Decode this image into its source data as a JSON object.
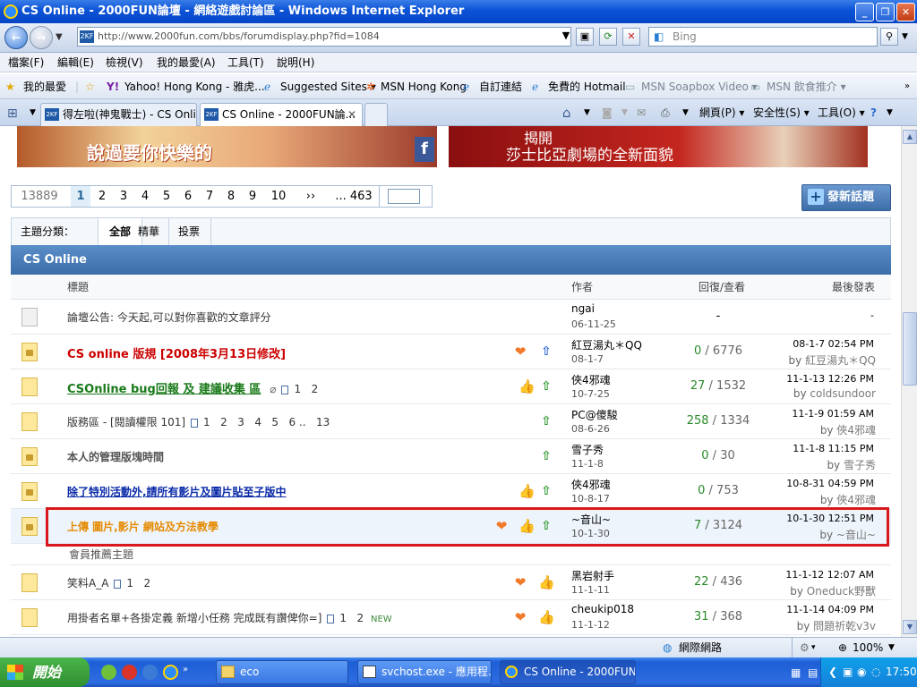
{
  "window": {
    "title": "CS Online - 2000FUN論壇 - 網絡遊戲討論區 - Windows Internet Explorer"
  },
  "address": {
    "url": "http://www.2000fun.com/bbs/forumdisplay.php?fid=1084",
    "favicon": "2KF"
  },
  "search": {
    "placeholder": "Bing"
  },
  "menu": [
    "檔案(F)",
    "編輯(E)",
    "檢視(V)",
    "我的最愛(A)",
    "工具(T)",
    "說明(H)"
  ],
  "favorites": {
    "label": "我的最愛",
    "items": [
      "Yahoo! Hong Kong - 雅虎...",
      "Suggested Sites ▾",
      "MSN Hong Kong",
      "自訂連結",
      "免費的 Hotmail",
      "MSN Soapbox Video ▾",
      "MSN 飲食推介 ▾"
    ]
  },
  "tabs": [
    "得左啦(神鬼戰士) - CS Onli...",
    "CS Online - 2000FUN論..."
  ],
  "commandbar": {
    "page": "網頁(P) ▾",
    "safety": "安全性(S) ▾",
    "tools": "工具(O) ▾"
  },
  "banners": {
    "right_text_1": "揭開",
    "right_text_2": "莎士比亞劇場的全新面貌",
    "left_text": "說過要你快樂的"
  },
  "pager": {
    "total": "13889",
    "pages": [
      "1",
      "2",
      "3",
      "4",
      "5",
      "6",
      "7",
      "8",
      "9",
      "10"
    ],
    "next": "››",
    "last": "... 463",
    "current": "1"
  },
  "new_topic_button": "發新話題",
  "categories": {
    "label": "主題分類：",
    "items": [
      "全部",
      "精華",
      "投票"
    ]
  },
  "forum": {
    "name": "CS Online"
  },
  "columns": {
    "title": "標題",
    "author": "作者",
    "replies_views": "回復/查看",
    "last_post": "最後發表"
  },
  "rows": [
    {
      "title": "論壇公告: 今天起,可以對你喜歡的文章評分",
      "author": "ngai",
      "date": "06-11-25",
      "replies": "-",
      "views": "",
      "last_time": "-",
      "last_by": ""
    },
    {
      "title": "CS online 版規 [2008年3月13日修改]",
      "author": "紅豆湯丸＊QQ",
      "date": "08-1-7",
      "replies": "0",
      "views": "6776",
      "last_time": "08-1-7 02:54 PM",
      "last_by_prefix": "by ",
      "last_by": "紅豆湯丸＊QQ"
    },
    {
      "title": "CSOnline bug回報 及 建議收集 區",
      "author": "俠4邪魂",
      "date": "10-7-25",
      "replies": "27",
      "views": "1532",
      "last_time": "11-1-13 12:26 PM",
      "last_by_prefix": "by ",
      "last_by": "coldsundoor",
      "pages": [
        "1",
        "2"
      ]
    },
    {
      "title": "版務區 - [閱讀權限 101]",
      "author": "PC@傻駿",
      "date": "08-6-26",
      "replies": "258",
      "views": "1334",
      "last_time": "11-1-9 01:59 AM",
      "last_by_prefix": "by ",
      "last_by": "俠4邪魂",
      "pages": [
        "1",
        "2",
        "3",
        "4",
        "5",
        "6 ..",
        "13"
      ]
    },
    {
      "title": "本人的管理版塊時間",
      "author": "雪子秀",
      "date": "11-1-8",
      "replies": "0",
      "views": "30",
      "last_time": "11-1-8 11:15 PM",
      "last_by_prefix": "by ",
      "last_by": "雪子秀"
    },
    {
      "title": "除了特別活動外,請所有影片及圖片貼至子版中",
      "author": "俠4邪魂",
      "date": "10-8-17",
      "replies": "0",
      "views": "753",
      "last_time": "10-8-31 04:59 PM",
      "last_by_prefix": "by ",
      "last_by": "俠4邪魂"
    },
    {
      "title": "上傳 圖片,影片 網站及方法教學",
      "author": "~音山~",
      "date": "10-1-30",
      "replies": "7",
      "views": "3124",
      "last_time": "10-1-30 12:51 PM",
      "last_by_prefix": "by ",
      "last_by": "~音山~"
    },
    {
      "title": "笑料A_A",
      "author": "黑岩射手",
      "date": "11-1-11",
      "replies": "22",
      "views": "436",
      "last_time": "11-1-12 12:07 AM",
      "last_by_prefix": "by ",
      "last_by": "Oneduck野獸",
      "pages": [
        "1",
        "2"
      ]
    },
    {
      "title": "用掛者名單+各掛定義 新增小任務 完成既有讚俾你=]",
      "author": "cheukip018",
      "date": "11-1-12",
      "replies": "31",
      "views": "368",
      "last_time": "11-1-14 04:09 PM",
      "last_by_prefix": "by ",
      "last_by": "問題祈乾v3v",
      "pages": [
        "1",
        "2"
      ],
      "badge": "NEW"
    }
  ],
  "section_label": "會員推薦主題",
  "status": {
    "zone": "網際網路",
    "zoom": "100%"
  },
  "taskbar": {
    "start": "開始",
    "items": [
      "eco",
      "svchost.exe - 應用程...",
      "CS Online - 2000FUN..."
    ],
    "clock": "17:50"
  },
  "colors": {
    "highlight_border": "#d9181c",
    "forum_header": "#3b6da9",
    "sticky_title": "#cc0000",
    "green_title": "#1a7a1a",
    "blue_title": "#0a2aa8",
    "orange_title": "#e58a00"
  }
}
